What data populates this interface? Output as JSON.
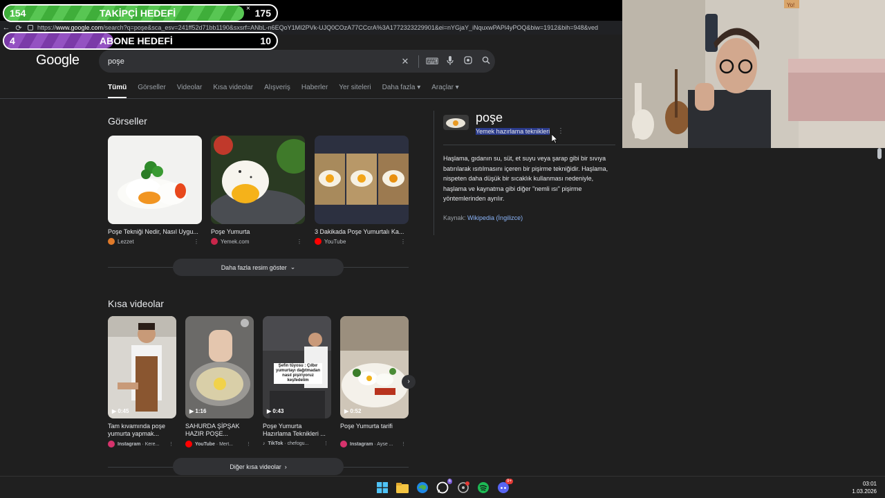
{
  "overlay": {
    "followers": {
      "current": "154",
      "label": "TAKİPÇİ HEDEFİ",
      "target": "175",
      "progress": 0.88,
      "close": "×"
    },
    "subscribers": {
      "current": "4",
      "label": "ABONE HEDEFİ",
      "target": "10",
      "progress": 0.4
    }
  },
  "browser": {
    "url_prefix": "https://",
    "url_host": "www.google.com",
    "url_rest": "/search?q=poşe&sca_esv=241ff52d71bb1190&sxsrf=ANbL-n6EQoY1MI2PVk-UJQ0COzA77CCcrA%3A1772323229901&ei=nYGjaY_iNquxwPAPl4yPOQ&biw=1912&bih=948&ved"
  },
  "google": {
    "logo": "Google",
    "query": "poşe",
    "tabs": [
      "Tümü",
      "Görseller",
      "Videolar",
      "Kısa videolar",
      "Alışveriş",
      "Haberler",
      "Yer siteleri",
      "Daha fazla ▾",
      "Araçlar ▾"
    ]
  },
  "images": {
    "title": "Görseller",
    "items": [
      {
        "caption": "Poşe Tekniği Nedir, Nasıl Uygu...",
        "source": "Lezzet",
        "color": "#e07a2a"
      },
      {
        "caption": "Poşe Yumurta",
        "source": "Yemek.com",
        "color": "#c8264a"
      },
      {
        "caption": "3 Dakikada Poşe Yumurtalı Ka...",
        "source": "YouTube",
        "color": "#ff0000"
      }
    ],
    "more_button": "Daha fazla resim göster"
  },
  "shorts": {
    "title": "Kısa videolar",
    "items": [
      {
        "duration": "0:45",
        "caption": "Tam kıvamında poşe yumurta yapmak...",
        "platform": "Instagram",
        "author": "· Kere...",
        "color": "#d6336c"
      },
      {
        "duration": "1:16",
        "caption": "SAHURDA ŞİPŞAK HAZIR POŞE...",
        "platform": "YouTube",
        "author": "· Mert...",
        "color": "#ff0000"
      },
      {
        "duration": "0:43",
        "caption": "Poşe Yumurta Hazırlama Teknikleri ...",
        "platform": "TikTok",
        "author": "· chefogu...",
        "color": "#111111",
        "overlay_text": "Şefin tüyosu : Çılbır yumurtayı dağıtmadan nasıl pişiriyoruz keşfedelim"
      },
      {
        "duration": "0:52",
        "caption": "Poşe Yumurta tarifi",
        "platform": "Instagram",
        "author": "· Ayse ...",
        "color": "#d6336c"
      }
    ],
    "more_button": "Diğer kısa videolar"
  },
  "knowledge_panel": {
    "title": "poşe",
    "subtitle": "Yemek hazırlama teknikleri",
    "description": "Haşlama, gıdanın su, süt, et suyu veya şarap gibi bir sıvıya batırılarak ısıtılmasını içeren bir pişirme tekniğidir. Haşlama, nispeten daha düşük bir sıcaklık kullanması nedeniyle, haşlama ve kaynatma gibi diğer \"nemli ısı\" pişirme yöntemlerinden ayrılır.",
    "source_label": "Kaynak:",
    "source_link": "Wikipedia (İngilizce)"
  },
  "webcam": {
    "poster_text": "Yo!"
  },
  "taskbar": {
    "icons": [
      "windows-start",
      "file-explorer",
      "edge",
      "whatsapp",
      "chrome-like",
      "spotify",
      "discord"
    ],
    "badges": {
      "whatsapp": "6",
      "discord": "9+"
    },
    "time": "03:01",
    "date": "1.03.2026"
  }
}
